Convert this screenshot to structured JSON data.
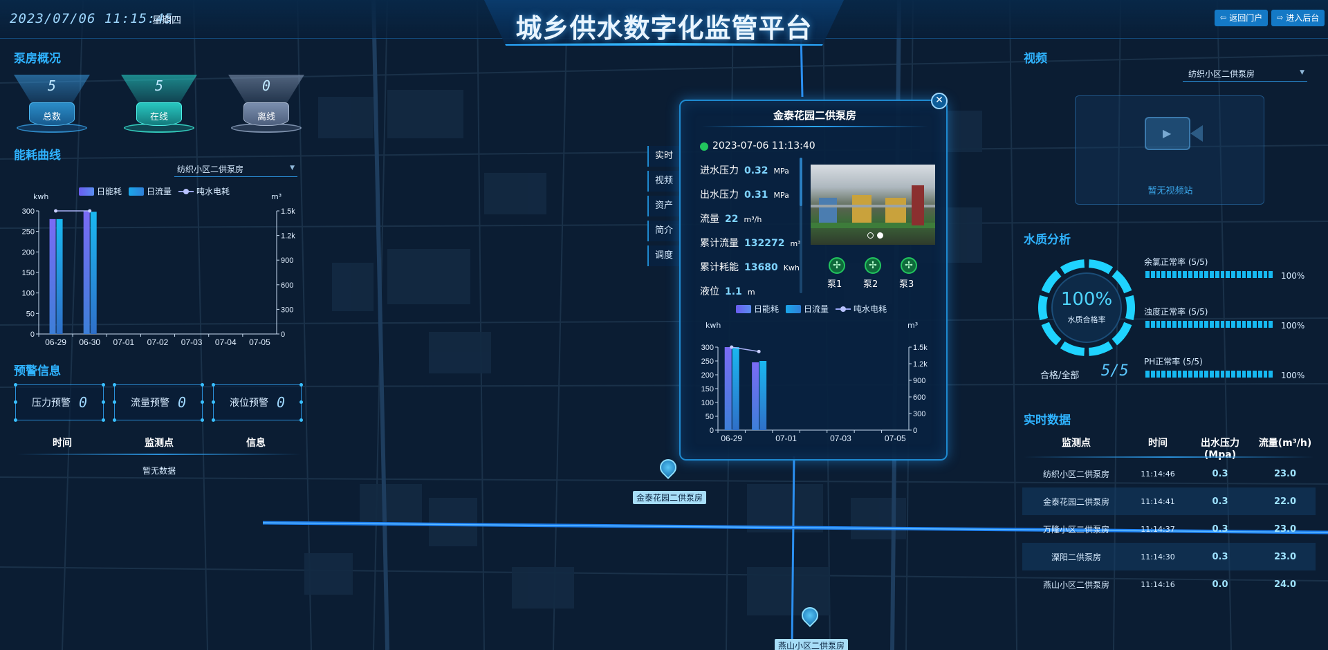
{
  "header": {
    "datetime": "2023/07/06 11:15:45",
    "weekday": "星期四",
    "title": "城乡供水数字化监管平台",
    "back_portal_label": "返回门户",
    "enter_admin_label": "进入后台"
  },
  "pump_overview": {
    "title": "泵房概况",
    "cards": [
      {
        "value": "5",
        "label": "总数"
      },
      {
        "value": "5",
        "label": "在线"
      },
      {
        "value": "0",
        "label": "离线"
      }
    ]
  },
  "energy": {
    "title": "能耗曲线",
    "selected_station": "纺织小区二供泵房",
    "legend": {
      "daily_energy": "日能耗",
      "daily_flow": "日流量",
      "per_ton": "吨水电耗"
    },
    "left_unit": "kwh",
    "right_unit": "m³"
  },
  "warnings": {
    "title": "预警信息",
    "boxes": [
      {
        "label": "压力预警",
        "value": "0"
      },
      {
        "label": "流量预警",
        "value": "0"
      },
      {
        "label": "液位预警",
        "value": "0"
      }
    ],
    "columns": [
      "时间",
      "监测点",
      "信息"
    ],
    "empty_text": "暂无数据"
  },
  "video": {
    "title": "视频",
    "selected_station": "纺织小区二供泵房",
    "empty_text": "暂无视频站"
  },
  "water_quality": {
    "title": "水质分析",
    "rate_value": "100%",
    "rate_label": "水质合格率",
    "ratio_label": "合格/全部",
    "ratio_value": "5/5",
    "ring_fraction": 1.0,
    "items": [
      {
        "name": "余氯正常率 (5/5)",
        "percent": "100%",
        "fraction": 1.0
      },
      {
        "name": "浊度正常率 (5/5)",
        "percent": "100%",
        "fraction": 1.0
      },
      {
        "name": "PH正常率 (5/5)",
        "percent": "100%",
        "fraction": 1.0
      }
    ]
  },
  "realtime": {
    "title": "实时数据",
    "columns": [
      "监测点",
      "时间",
      "出水压力(Mpa)",
      "流量(m³/h)"
    ],
    "rows": [
      {
        "station": "纺织小区二供泵房",
        "time": "11:14:46",
        "pressure": "0.3",
        "flow": "23.0"
      },
      {
        "station": "金泰花园二供泵房",
        "time": "11:14:41",
        "pressure": "0.3",
        "flow": "22.0"
      },
      {
        "station": "万隆小区二供泵房",
        "time": "11:14:37",
        "pressure": "0.3",
        "flow": "23.0"
      },
      {
        "station": "溧阳二供泵房",
        "time": "11:14:30",
        "pressure": "0.3",
        "flow": "23.0"
      },
      {
        "station": "燕山小区二供泵房",
        "time": "11:14:16",
        "pressure": "0.0",
        "flow": "24.0"
      }
    ]
  },
  "popup": {
    "title": "金泰花园二供泵房",
    "close_icon": "close-icon",
    "time": "2023-07-06 11:13:40",
    "status_color": "#22c55e",
    "tabs": [
      "实时",
      "视频",
      "资产",
      "简介",
      "调度"
    ],
    "metrics": [
      {
        "label": "进水压力",
        "value": "0.32",
        "unit": "MPa"
      },
      {
        "label": "出水压力",
        "value": "0.31",
        "unit": "MPa"
      },
      {
        "label": "流量",
        "value": "22",
        "unit": "m³/h"
      },
      {
        "label": "累计流量",
        "value": "132272",
        "unit": "m³"
      },
      {
        "label": "累计耗能",
        "value": "13680",
        "unit": "Kwh"
      },
      {
        "label": "液位",
        "value": "1.1",
        "unit": "m"
      }
    ],
    "pumps": [
      "泵1",
      "泵2",
      "泵3"
    ],
    "legend": {
      "daily_energy": "日能耗",
      "daily_flow": "日流量",
      "per_ton": "吨水电耗"
    },
    "left_unit": "kwh",
    "right_unit": "m³"
  },
  "map_markers": [
    "金泰花园二供泵房",
    "燕山小区二供泵房"
  ],
  "chart_data": [
    {
      "type": "bar",
      "categories": [
        "06-29",
        "06-30",
        "07-01",
        "07-02",
        "07-03",
        "07-04",
        "07-05"
      ],
      "series": [
        {
          "name": "日能耗",
          "values": [
            280,
            300,
            0,
            0,
            0,
            0,
            0
          ],
          "axis": "left"
        },
        {
          "name": "日流量",
          "values": [
            280,
            298,
            0,
            0,
            0,
            0,
            0
          ],
          "axis": "left"
        },
        {
          "name": "吨水电耗",
          "type": "line",
          "values": [
            1500,
            1500,
            null,
            null,
            null,
            null,
            null
          ],
          "axis": "right"
        }
      ],
      "ylabel": "kwh",
      "y2label": "m³",
      "ylim": [
        0,
        300
      ],
      "yticks": [
        0,
        50,
        100,
        150,
        200,
        250,
        300
      ],
      "y2lim": [
        0,
        1500
      ],
      "y2ticks": [
        "0",
        "300",
        "600",
        "900",
        "1.2k",
        "1.5k"
      ]
    },
    {
      "type": "bar",
      "categories": [
        "06-29",
        "06-30",
        "07-01",
        "07-02",
        "07-03",
        "07-04",
        "07-05"
      ],
      "xticks": [
        "06-29",
        "07-01",
        "07-03",
        "07-05"
      ],
      "series": [
        {
          "name": "日能耗",
          "values": [
            300,
            245,
            0,
            0,
            0,
            0,
            0
          ],
          "axis": "left"
        },
        {
          "name": "日流量",
          "values": [
            300,
            250,
            0,
            0,
            0,
            0,
            0
          ],
          "axis": "left"
        },
        {
          "name": "吨水电耗",
          "type": "line",
          "values": [
            1500,
            1420,
            null,
            null,
            null,
            null,
            null
          ],
          "axis": "right"
        }
      ],
      "ylabel": "kwh",
      "y2label": "m³",
      "ylim": [
        0,
        300
      ],
      "yticks": [
        0,
        50,
        100,
        150,
        200,
        250,
        300
      ],
      "y2lim": [
        0,
        1500
      ],
      "y2ticks": [
        "0",
        "300",
        "600",
        "900",
        "1.2k",
        "1.5k"
      ]
    }
  ]
}
